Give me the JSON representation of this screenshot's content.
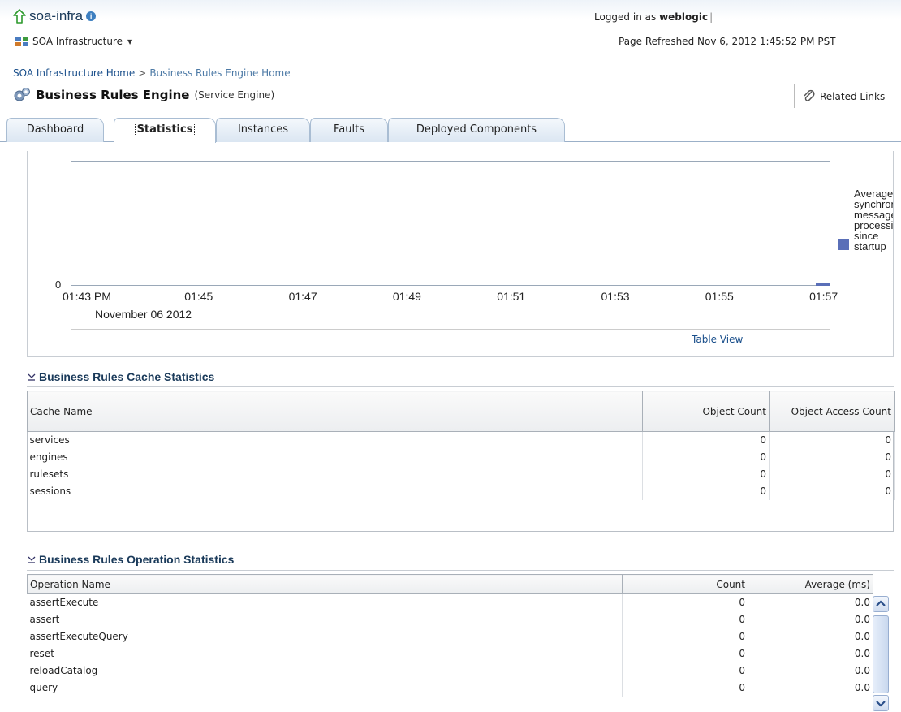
{
  "header": {
    "app_title": "soa-infra",
    "menu_label": "SOA Infrastructure",
    "login_prefix": "Logged in as",
    "login_user": "weblogic",
    "refreshed": "Page Refreshed Nov 6, 2012 1:45:52 PM PST"
  },
  "breadcrumb": {
    "home": "SOA Infrastructure Home",
    "separator": ">",
    "current": "Business Rules Engine Home"
  },
  "page": {
    "title": "Business Rules Engine",
    "subtitle": "(Service Engine)",
    "related_links": "Related Links"
  },
  "tabs": [
    {
      "label": "Dashboard",
      "active": false
    },
    {
      "label": "Statistics",
      "active": true
    },
    {
      "label": "Instances",
      "active": false
    },
    {
      "label": "Faults",
      "active": false
    },
    {
      "label": "Deployed Components",
      "active": false
    }
  ],
  "chart_data": {
    "type": "line",
    "y_tick": "0",
    "x_ticks": [
      "01:43 PM",
      "01:45",
      "01:47",
      "01:49",
      "01:51",
      "01:53",
      "01:55",
      "01:57"
    ],
    "x_date_label": "November 06 2012",
    "legend_text": "Average\nsynchronous\nmessage\nprocessing\nsince\nstartup",
    "series_color": "#5a6fb8",
    "table_view_link": "Table View"
  },
  "cache_stats": {
    "title": "Business Rules Cache Statistics",
    "columns": [
      "Cache Name",
      "Object Count",
      "Object Access Count"
    ],
    "rows": [
      [
        "services",
        "0",
        "0"
      ],
      [
        "engines",
        "0",
        "0"
      ],
      [
        "rulesets",
        "0",
        "0"
      ],
      [
        "sessions",
        "0",
        "0"
      ]
    ]
  },
  "operation_stats": {
    "title": "Business Rules Operation Statistics",
    "columns": [
      "Operation Name",
      "Count",
      "Average (ms)"
    ],
    "rows": [
      [
        "assertExecute",
        "0",
        "0.0"
      ],
      [
        "assert",
        "0",
        "0.0"
      ],
      [
        "assertExecuteQuery",
        "0",
        "0.0"
      ],
      [
        "reset",
        "0",
        "0.0"
      ],
      [
        "reloadCatalog",
        "0",
        "0.0"
      ],
      [
        "query",
        "0",
        "0.0"
      ]
    ]
  }
}
